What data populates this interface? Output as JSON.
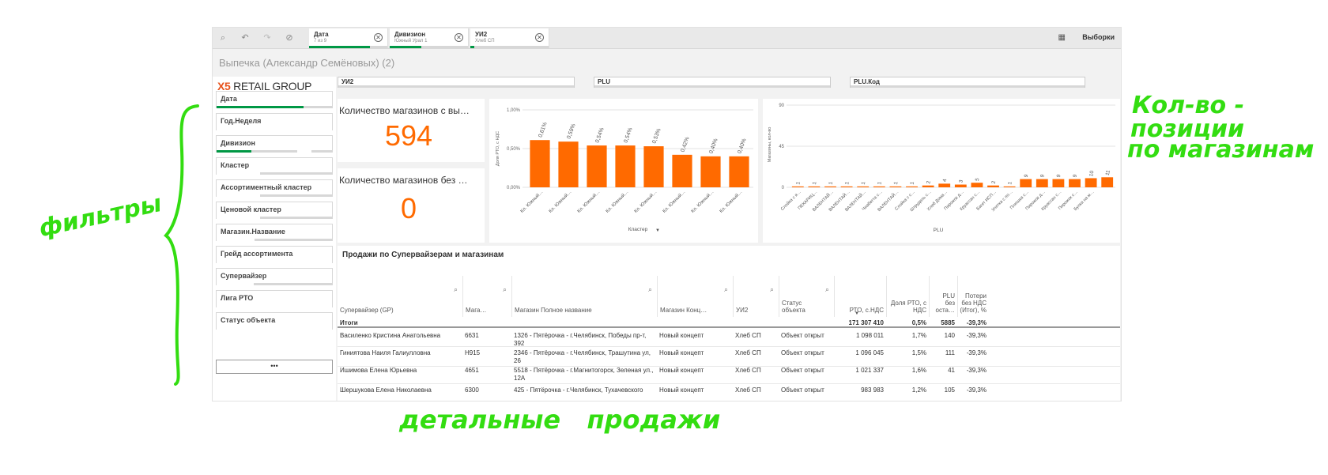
{
  "toolbar": {
    "chips": [
      {
        "title": "Дата",
        "subtitle": "7 из 9",
        "fill": 0.78
      },
      {
        "title": "Дивизион",
        "subtitle": "Южный Урал 1",
        "fill": 0.4
      },
      {
        "title": "УИ2",
        "subtitle": "Хлеб СП",
        "fill": 0.05
      }
    ],
    "selections_label": "Выборки"
  },
  "app_title": "Выпечка (Александр Семёновых) (2)",
  "logo": {
    "x": "X5",
    "text": "RETAIL GROUP"
  },
  "filters": [
    {
      "label": "Дата",
      "fill": 0.75
    },
    {
      "label": "Год.Неделя",
      "fill": 0
    },
    {
      "label": "Дивизион",
      "fill": 0.3
    },
    {
      "label": "Кластер",
      "fill": 0
    },
    {
      "label": "Ассортиментный кластер",
      "fill": 0
    },
    {
      "label": "Ценовой кластер",
      "fill": 0
    },
    {
      "label": "Магазин.Название",
      "fill": 0
    },
    {
      "label": "Грейд ассортимента",
      "fill": 0
    },
    {
      "label": "Супервайзер",
      "fill": 0
    },
    {
      "label": "Лига РТО",
      "fill": 0
    },
    {
      "label": "Статус объекта",
      "fill": 0
    }
  ],
  "more_label": "•••",
  "top_filters": [
    "УИ2",
    "PLU",
    "PLU.Код"
  ],
  "kpis": [
    {
      "title": "Количество магазинов с вы…",
      "value": "594"
    },
    {
      "title": "Количество магазинов без …",
      "value": "0"
    }
  ],
  "chart_data": [
    {
      "type": "bar",
      "ylabel": "Доля РТО, с НДС",
      "xlabel": "Кластер",
      "ylim": [
        0,
        1
      ],
      "ytick_labels": [
        "1,00%",
        "0,50%",
        "0,00%"
      ],
      "categories": [
        "Кл. Южный…",
        "Кл. Южный…",
        "Кл. Южный…",
        "Кл. Южный…",
        "Кл. Южный…",
        "Кл. Южный…",
        "Кл. Южный…",
        "Кл. Южный…"
      ],
      "values": [
        0.61,
        0.59,
        0.54,
        0.54,
        0.53,
        0.42,
        0.4,
        0.4
      ],
      "labels": [
        "0,61%",
        "0,59%",
        "0,54%",
        "0,54%",
        "0,53%",
        "0,42%",
        "0,40%",
        "0,40%"
      ],
      "color": "#ff6a00"
    },
    {
      "type": "bar",
      "ylabel": "Магазины, кол-во",
      "xlabel": "PLU",
      "ylim": [
        0,
        90
      ],
      "ytick_labels": [
        "90",
        "45",
        "0"
      ],
      "categories": [
        "Слойка с я…",
        "ПЕКАРИЦ…",
        "ВАЛЕНТАЙ…",
        "ВАЛЕНТАЙ…",
        "ВАЛЕНТАЙ…",
        "Чиабатта с…",
        "ВАЛЕНТАЙ…",
        "Слойка с с…",
        "Штрудель с…",
        "Хлеб Дома…",
        "Пирожок д…",
        "Круассан с…",
        "Багет ИСП…",
        "Улитка с по…",
        "Плюшка с…",
        "Пирожок д…",
        "Круассан с…",
        "Пирожок с…",
        "Булка на м…"
      ],
      "values": [
        1,
        1,
        1,
        1,
        1,
        1,
        1,
        1,
        2,
        4,
        3,
        5,
        2,
        1,
        9,
        9,
        9,
        9,
        10,
        11
      ],
      "color": "#ff6a00"
    }
  ],
  "table": {
    "title": "Продажи по Супервайзерам и магазинам",
    "columns": [
      "Супервайзер (GP)",
      "Мага…",
      "Магазин Полное название",
      "Магазин Конц…",
      "УИ2",
      "Статус объекта",
      "РТО, с.НДС",
      "Доля РТО, с НДС",
      "PLU без оста…",
      "Потери без НДС (Итог), %"
    ],
    "totals": {
      "label": "Итоги",
      "rto": "171 307 410",
      "share": "0,5%",
      "plu": "5885",
      "loss": "-39,3%"
    },
    "rows": [
      {
        "sv": "Василенко Кристина Анатольевна",
        "code": "6631",
        "name": "1326 - Пятёрочка - г.Челябинск, Победы пр-т, 392",
        "concept": "Новый концепт",
        "ui2": "Хлеб СП",
        "status": "Объект открыт",
        "rto": "1 098 011",
        "share": "1,7%",
        "plu": "140",
        "loss": "-39,3%"
      },
      {
        "sv": "Гиниятова Наиля Галиулловна",
        "code": "Н915",
        "name": "2346 - Пятёрочка - г.Челябинск, Трашутина ул, 26",
        "concept": "Новый концепт",
        "ui2": "Хлеб СП",
        "status": "Объект открыт",
        "rto": "1 096 045",
        "share": "1,5%",
        "plu": "111",
        "loss": "-39,3%"
      },
      {
        "sv": "Ишимова Елена Юрьевна",
        "code": "4651",
        "name": "5518 - Пятёрочка - г.Магнитогорск, Зеленая ул., 12А",
        "concept": "Новый концепт",
        "ui2": "Хлеб СП",
        "status": "Объект открыт",
        "rto": "1 021 337",
        "share": "1,6%",
        "plu": "41",
        "loss": "-39,3%"
      },
      {
        "sv": "Шершукова Елена Николаевна",
        "code": "6300",
        "name": "425 - Пятёрочка - г.Челябинск, Тухачевского",
        "concept": "Новый концепт",
        "ui2": "Хлеб СП",
        "status": "Объект открыт",
        "rto": "983 983",
        "share": "1,2%",
        "plu": "105",
        "loss": "-39,3%"
      }
    ]
  },
  "annotations": {
    "filters": "фильтры",
    "count_line1": "Кол-во -",
    "count_line2": "позиции",
    "count_line3": "по магазинам",
    "details": "детальные   продажи"
  }
}
